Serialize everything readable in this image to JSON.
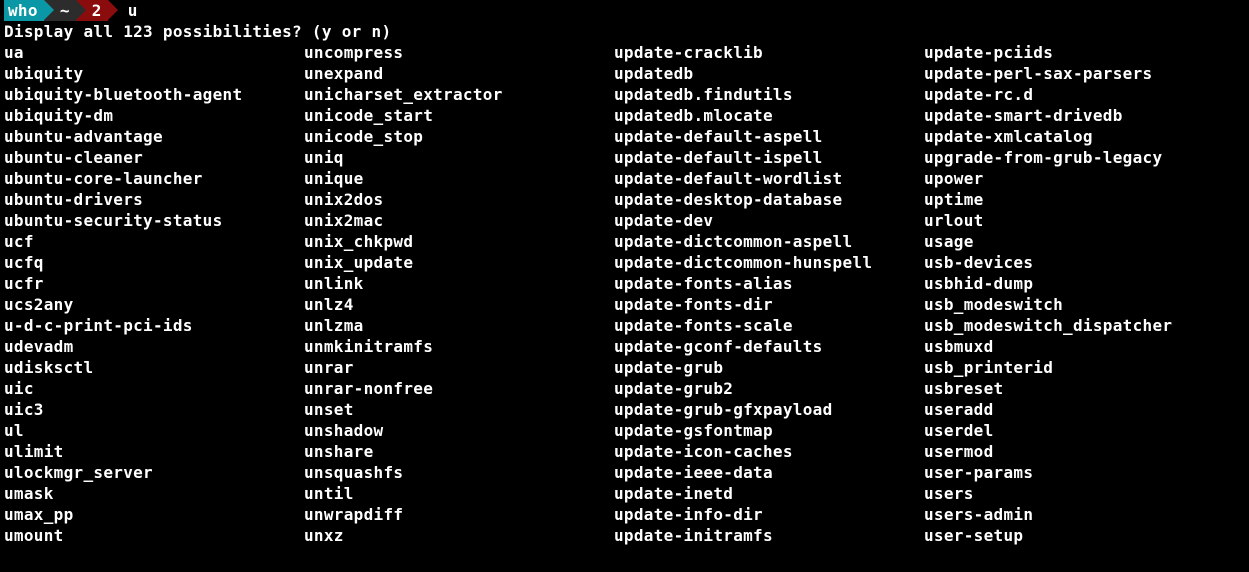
{
  "prompt": {
    "user": "who",
    "path": "~",
    "ret": "2",
    "typed": "u"
  },
  "question": "Display all 123 possibilities? (y or n)",
  "columns": [
    [
      "ua",
      "ubiquity",
      "ubiquity-bluetooth-agent",
      "ubiquity-dm",
      "ubuntu-advantage",
      "ubuntu-cleaner",
      "ubuntu-core-launcher",
      "ubuntu-drivers",
      "ubuntu-security-status",
      "ucf",
      "ucfq",
      "ucfr",
      "ucs2any",
      "u-d-c-print-pci-ids",
      "udevadm",
      "udisksctl",
      "uic",
      "uic3",
      "ul",
      "ulimit",
      "ulockmgr_server",
      "umask",
      "umax_pp",
      "umount"
    ],
    [
      "uncompress",
      "unexpand",
      "unicharset_extractor",
      "unicode_start",
      "unicode_stop",
      "uniq",
      "unique",
      "unix2dos",
      "unix2mac",
      "unix_chkpwd",
      "unix_update",
      "unlink",
      "unlz4",
      "unlzma",
      "unmkinitramfs",
      "unrar",
      "unrar-nonfree",
      "unset",
      "unshadow",
      "unshare",
      "unsquashfs",
      "until",
      "unwrapdiff",
      "unxz"
    ],
    [
      "update-cracklib",
      "updatedb",
      "updatedb.findutils",
      "updatedb.mlocate",
      "update-default-aspell",
      "update-default-ispell",
      "update-default-wordlist",
      "update-desktop-database",
      "update-dev",
      "update-dictcommon-aspell",
      "update-dictcommon-hunspell",
      "update-fonts-alias",
      "update-fonts-dir",
      "update-fonts-scale",
      "update-gconf-defaults",
      "update-grub",
      "update-grub2",
      "update-grub-gfxpayload",
      "update-gsfontmap",
      "update-icon-caches",
      "update-ieee-data",
      "update-inetd",
      "update-info-dir",
      "update-initramfs"
    ],
    [
      "update-pciids",
      "update-perl-sax-parsers",
      "update-rc.d",
      "update-smart-drivedb",
      "update-xmlcatalog",
      "upgrade-from-grub-legacy",
      "upower",
      "uptime",
      "urlout",
      "usage",
      "usb-devices",
      "usbhid-dump",
      "usb_modeswitch",
      "usb_modeswitch_dispatcher",
      "usbmuxd",
      "usb_printerid",
      "usbreset",
      "useradd",
      "userdel",
      "usermod",
      "user-params",
      "users",
      "users-admin",
      "user-setup"
    ]
  ]
}
